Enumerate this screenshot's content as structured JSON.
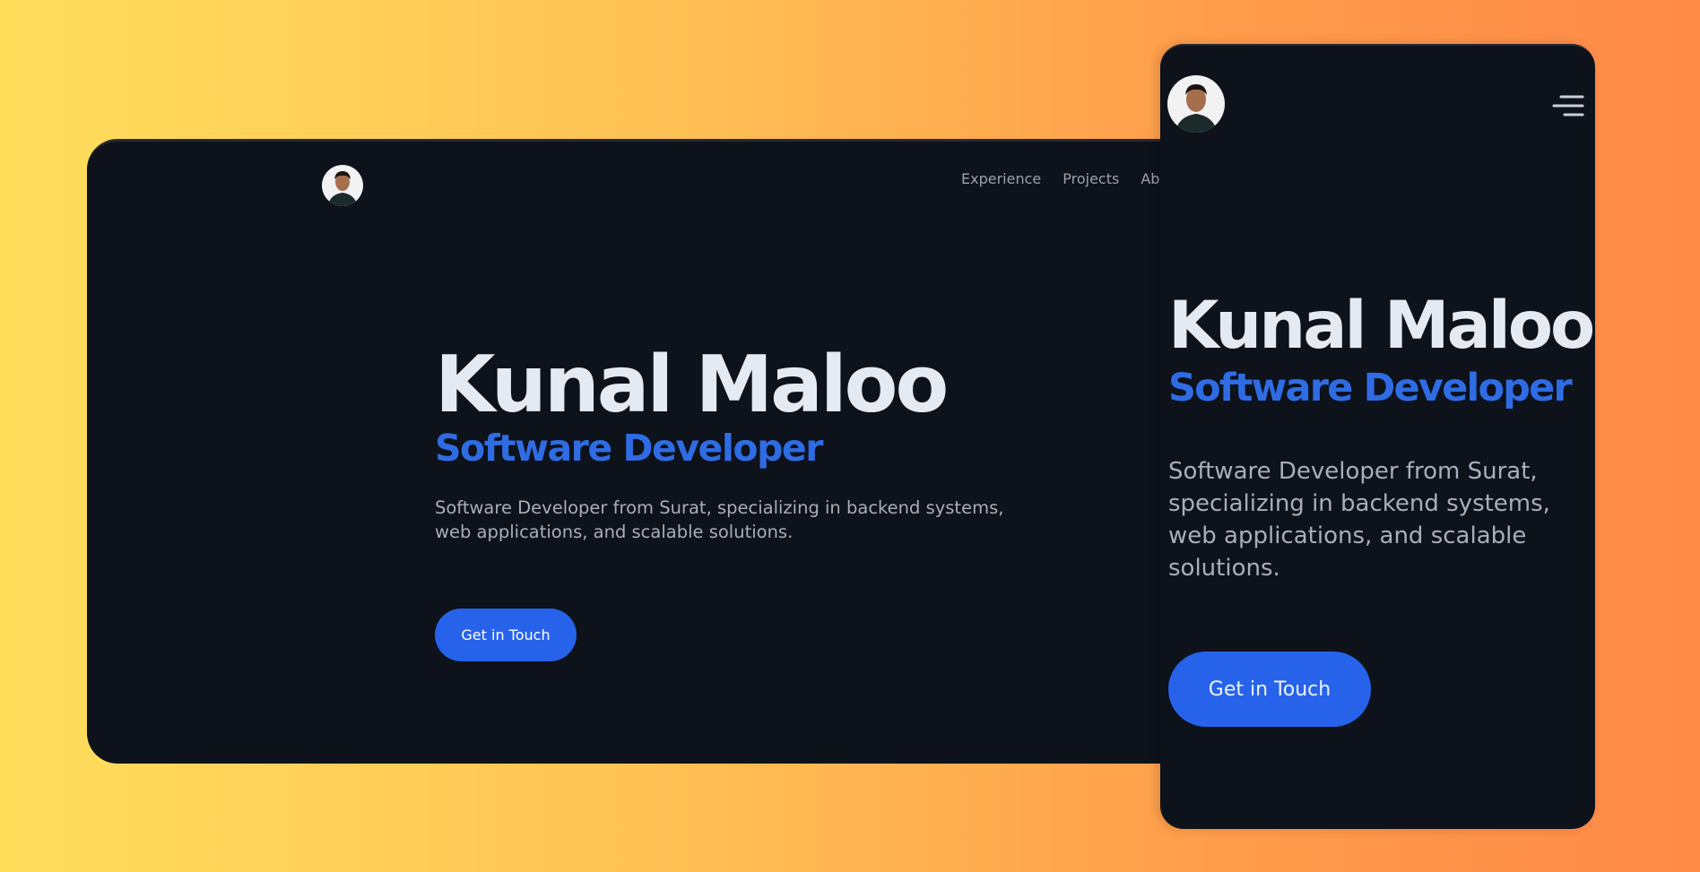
{
  "desktop": {
    "nav": {
      "items": [
        {
          "label": "Experience"
        },
        {
          "label": "Projects"
        },
        {
          "label": "About"
        }
      ]
    },
    "hero": {
      "name": "Kunal Maloo",
      "role": "Software Developer",
      "description": "Software Developer from Surat, specializing in backend systems, web applications, and scalable solutions.",
      "cta_label": "Get in Touch"
    }
  },
  "mobile": {
    "menu_icon": "hamburger-menu-icon",
    "hero": {
      "name": "Kunal Maloo",
      "role": "Software Developer",
      "description": "Software Developer from Surat, specializing in backend systems, web applications, and scalable solutions.",
      "cta_label": "Get in Touch"
    }
  },
  "colors": {
    "background_gradient_start": "#ffde5c",
    "background_gradient_end": "#ff8a48",
    "panel": "#0d121b",
    "accent": "#2663ea",
    "heading": "#e4e9f2",
    "body_text": "#a7afbd"
  }
}
